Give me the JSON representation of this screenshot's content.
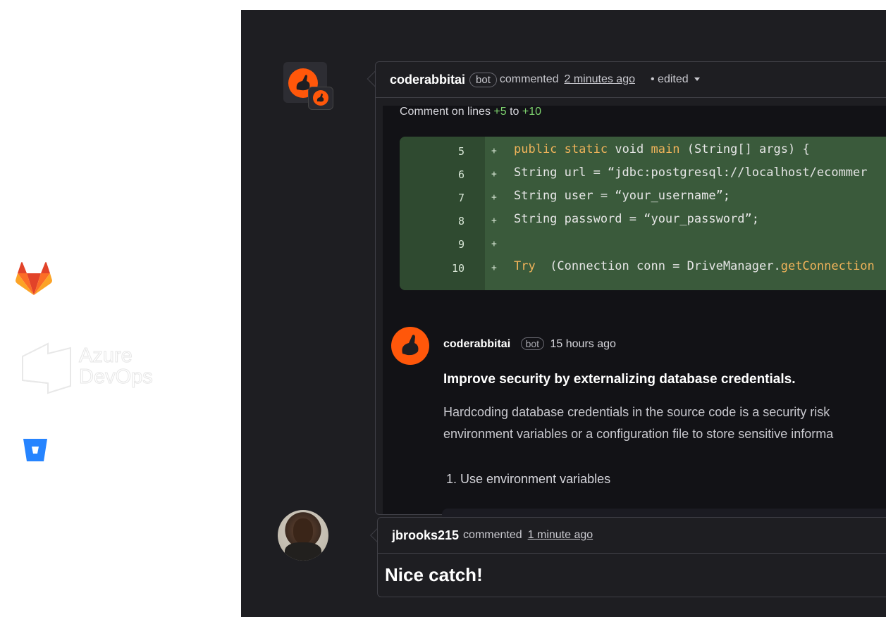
{
  "integrations": {
    "azure_label_line1": "Azure",
    "azure_label_line2": "DevOps"
  },
  "thread": {
    "first_comment": {
      "author": "coderabbitai",
      "badge": "bot",
      "action": "commented",
      "time": "2 minutes ago",
      "edited": "• edited",
      "comment_on_prefix": "Comment on lines",
      "range_start": "+5",
      "range_to": "to",
      "range_end": "+10",
      "diff": [
        {
          "num": "5",
          "sign": "+"
        },
        {
          "num": "6",
          "sign": "+"
        },
        {
          "num": "7",
          "sign": "+"
        },
        {
          "num": "8",
          "sign": "+"
        },
        {
          "num": "9",
          "sign": "+"
        },
        {
          "num": "10",
          "sign": "+"
        }
      ],
      "code": {
        "l5_kw1": "public",
        "l5_kw2": "static",
        "l5_rest1": " void ",
        "l5_fn": "main",
        "l5_rest2": " (String[] args) {",
        "l6": "String url = “jdbc:postgresql://localhost/ecommer",
        "l7": "String user = “your_username”;",
        "l8": "String password = “your_password”;",
        "l10_kw": "Try",
        "l10_rest": "  (Connection conn = DriveManager.",
        "l10_fn": "getConnection"
      },
      "reply": {
        "author": "coderabbitai",
        "badge": "bot",
        "time": "15 hours ago",
        "title": "Improve security by externalizing database credentials.",
        "text_line1": "Hardcoding database credentials in the source code is a security risk",
        "text_line2": "environment variables or a configuration file to store sensitive informa",
        "list_item": "1. Use environment variables"
      }
    },
    "second_comment": {
      "author": "jbrooks215",
      "action": "commented",
      "time": "1 minute ago",
      "message": "Nice catch!"
    }
  },
  "colors": {
    "brand_orange": "#ff570a",
    "panel_bg": "#1e1e22",
    "diff_added": "#3a5a3b"
  }
}
